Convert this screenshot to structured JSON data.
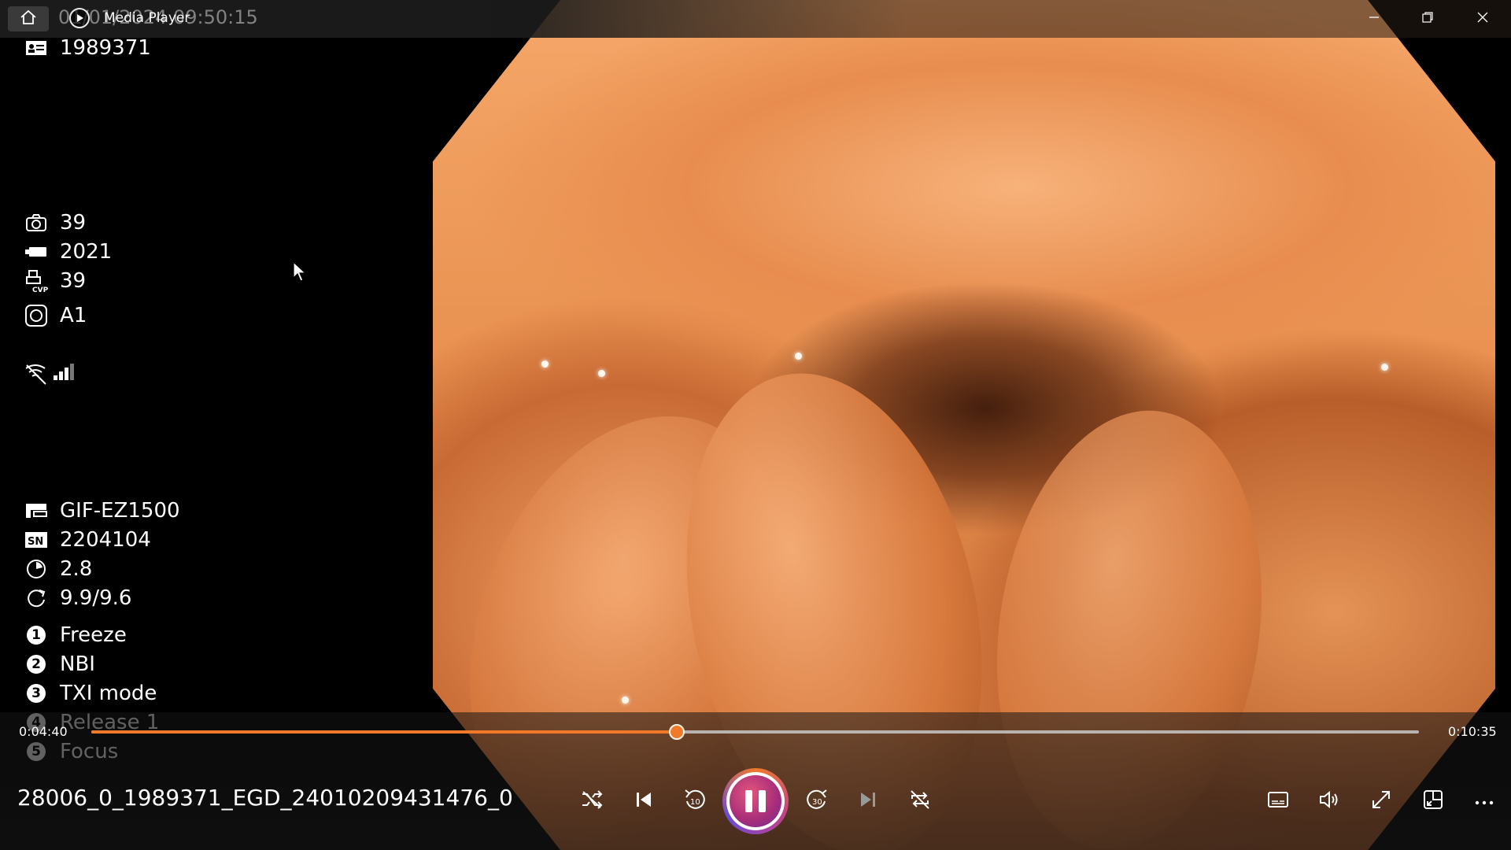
{
  "window": {
    "app_title": "Media Player",
    "overlay_timestamp": "01/01/2024 09:50:15"
  },
  "info_panel": {
    "patient_id": "1989371",
    "photo_count": "39",
    "storage": "2021",
    "cvp_count": "39",
    "mode": "A1",
    "scope_model": "GIF-EZ1500",
    "serial_number": "2204104",
    "value_a": "2.8",
    "value_b": "9.9/9.6",
    "functions": [
      {
        "index": "1",
        "label": "Freeze"
      },
      {
        "index": "2",
        "label": "NBI"
      },
      {
        "index": "3",
        "label": "TXI mode"
      },
      {
        "index": "4",
        "label": "Release 1"
      },
      {
        "index": "5",
        "label": "Focus"
      }
    ]
  },
  "playback": {
    "current_time": "0:04:40",
    "total_time": "0:10:35",
    "progress_fraction": 0.4409,
    "file_name": "28006_0_1989371_EGD_24010209431476_0"
  },
  "icons": {
    "home": "home-icon",
    "app": "media-player-icon",
    "minimize": "minimize-icon",
    "restore": "restore-icon",
    "close": "close-icon",
    "shuffle": "shuffle-icon",
    "previous": "previous-icon",
    "rewind": "rewind-10-icon",
    "pause": "pause-icon",
    "forward": "forward-30-icon",
    "next": "next-icon",
    "repeat": "repeat-off-icon",
    "subtitles": "subtitles-icon",
    "volume": "volume-icon",
    "fullscreen": "fullscreen-icon",
    "miniplayer": "miniplayer-icon",
    "more": "more-icon"
  },
  "colors": {
    "accent": "#f07a2a",
    "play_gradient": [
      "#e3557c",
      "#6b2c9a"
    ]
  }
}
